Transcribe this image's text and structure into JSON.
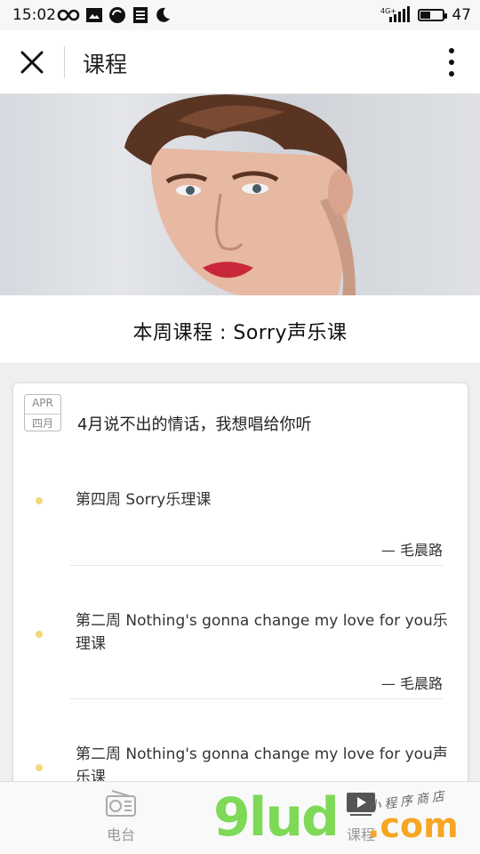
{
  "status_bar": {
    "time": "15:02",
    "network": "4G",
    "battery": "47",
    "battery_level": 0.47
  },
  "nav": {
    "title": "课程"
  },
  "banner": {
    "icon": "portrait-photo"
  },
  "course": {
    "title": "本周课程 : Sorry声乐课"
  },
  "card": {
    "date_badge": {
      "month_en": "APR",
      "month_cn": "四月"
    },
    "heading": "4月说不出的情话，我想唱给你听",
    "items": [
      {
        "title": "第四周 Sorry乐理课",
        "author": "— 毛晨路"
      },
      {
        "title": "第二周 Nothing's gonna change my love for you乐理课",
        "author": "— 毛晨路"
      },
      {
        "title": "第二周 Nothing's gonna change my love for you声乐课",
        "author": ""
      }
    ]
  },
  "tabs": [
    {
      "label": "电台",
      "icon": "radio-icon"
    },
    {
      "label": "课程",
      "icon": "video-icon"
    }
  ],
  "watermark": {
    "logo": "9lud.com",
    "tag": "小程序商店"
  },
  "colors": {
    "accent_dot": "#f3d77a",
    "watermark_green": "#7ed957",
    "watermark_orange": "#f5a623"
  }
}
